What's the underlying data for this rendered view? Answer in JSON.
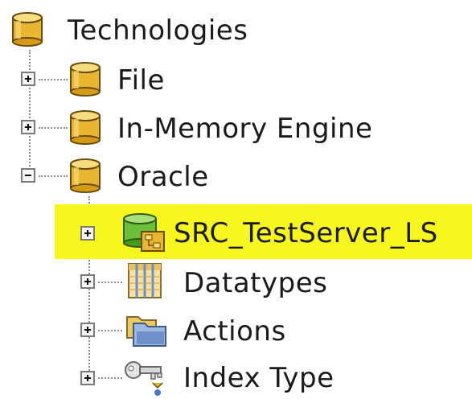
{
  "tree": {
    "root": {
      "label": "Technologies",
      "icon": "database-folder-icon"
    },
    "nodes": [
      {
        "label": "File",
        "icon": "database-folder-icon",
        "expanded": false
      },
      {
        "label": "In-Memory Engine",
        "icon": "database-folder-icon",
        "expanded": false
      },
      {
        "label": "Oracle",
        "icon": "database-folder-icon",
        "expanded": true,
        "children": [
          {
            "label": "SRC_TestServer_LS",
            "icon": "logical-schema-icon",
            "expanded": false,
            "selected": true
          },
          {
            "label": "Datatypes",
            "icon": "table-grid-icon",
            "expanded": false
          },
          {
            "label": "Actions",
            "icon": "folders-icon",
            "expanded": false
          },
          {
            "label": "Index Type",
            "icon": "key-icon",
            "expanded": false
          }
        ]
      }
    ]
  },
  "colors": {
    "highlight": "#f7f71f",
    "cylinder": "#e8b630",
    "schema_green": "#6bbf3a"
  }
}
